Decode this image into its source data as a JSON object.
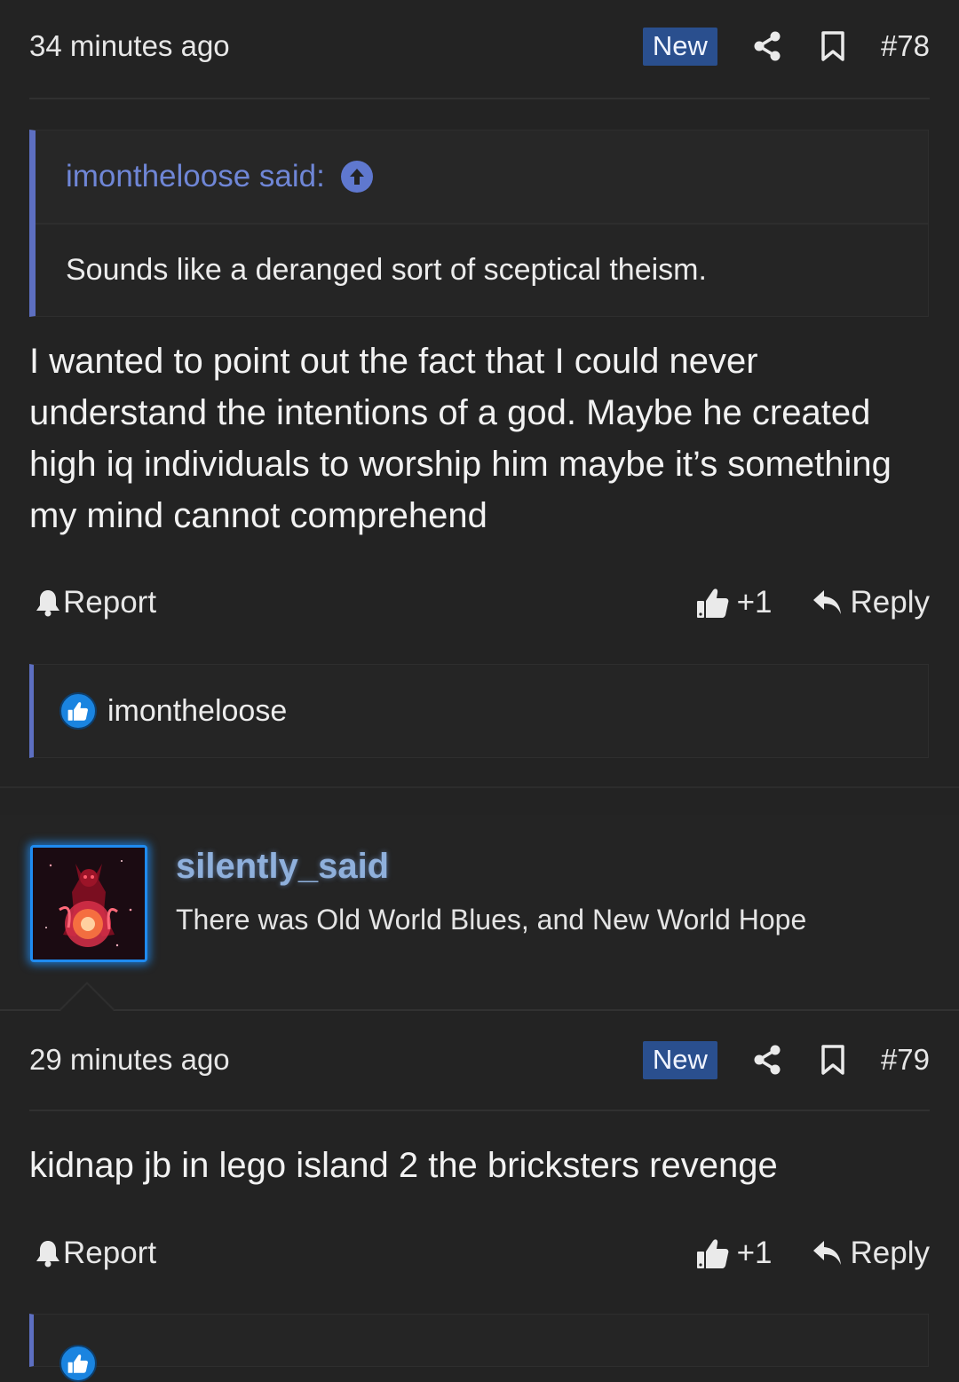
{
  "post78": {
    "time": "34 minutes ago",
    "badge": "New",
    "number": "#78",
    "quote": {
      "author": "imontheloose said:",
      "text": "Sounds like a deranged sort of sceptical theism."
    },
    "body": "I wanted to point out the fact that I could never understand the intentions of a god. Maybe he created high iq individuals to worship him maybe it’s something my mind cannot comprehend",
    "report_label": "Report",
    "like_label": "+1",
    "reply_label": "Reply",
    "reaction_user": "imontheloose"
  },
  "author79": {
    "username": "silently_said",
    "title": "There was Old World Blues, and New World Hope"
  },
  "post79": {
    "time": "29 minutes ago",
    "badge": "New",
    "number": "#79",
    "body": "kidnap jb in lego island 2 the bricksters revenge",
    "report_label": "Report",
    "like_label": "+1",
    "reply_label": "Reply"
  },
  "colors": {
    "background": "#232323",
    "accent": "#5d6fc1",
    "badge": "#2a4f8e",
    "reaction": "#1a84e0"
  }
}
